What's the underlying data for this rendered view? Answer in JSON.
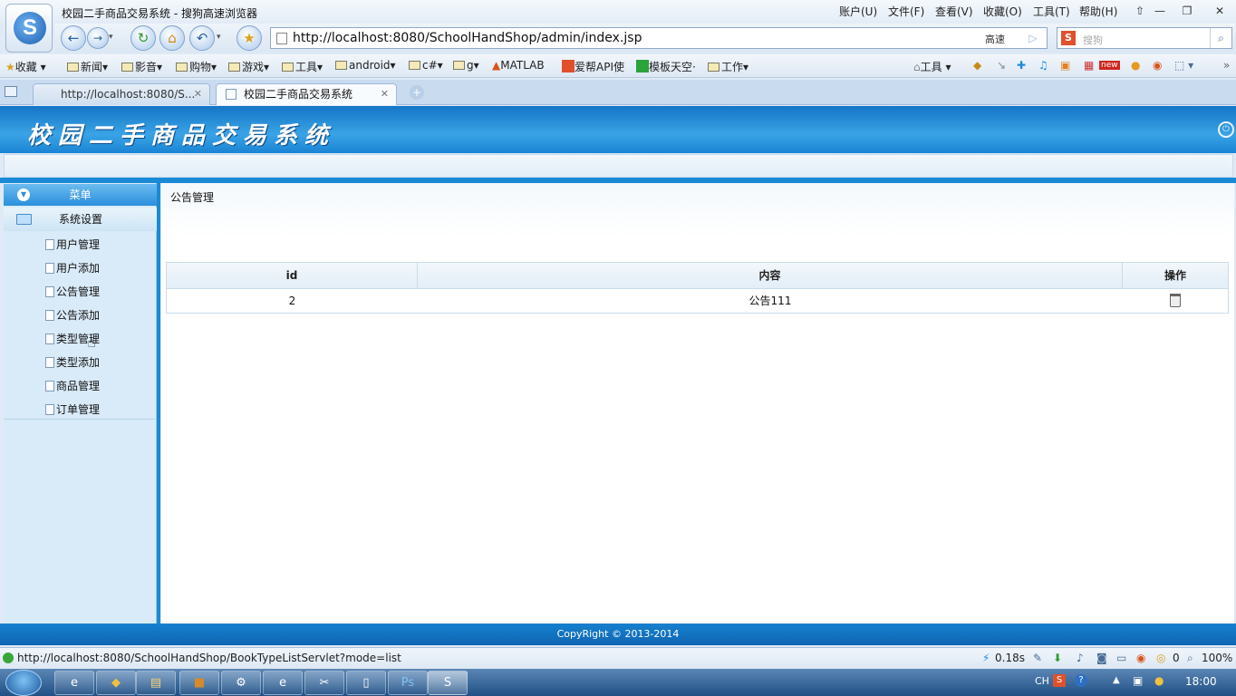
{
  "browser": {
    "window_title": "校园二手商品交易系统 - 搜狗高速浏览器",
    "menus": [
      "账户(U)",
      "文件(F)",
      "查看(V)",
      "收藏(O)",
      "工具(T)",
      "帮助(H)"
    ],
    "address": "http://localhost:8080/SchoolHandShop/admin/index.jsp",
    "speed_mode": "高速",
    "search_placeholder": "搜狗",
    "favorites": [
      "收藏",
      "新闻",
      "影音",
      "购物",
      "游戏",
      "工具",
      "android",
      "c#",
      "g",
      "MATLAB",
      "爱帮API使",
      "模板天空·",
      "工作"
    ],
    "tools_label": "工具",
    "new_badge": "new",
    "tabs": [
      {
        "label": "http://localhost:8080/S...",
        "active": false
      },
      {
        "label": "校园二手商品交易系统",
        "active": true
      }
    ]
  },
  "app": {
    "title": "校园二手商品交易系统",
    "sidebar": {
      "header": "菜单",
      "group": "系统设置",
      "items": [
        "用户管理",
        "用户添加",
        "公告管理",
        "公告添加",
        "类型管理",
        "类型添加",
        "商品管理",
        "订单管理"
      ]
    },
    "breadcrumb": "公告管理",
    "table": {
      "columns": [
        "id",
        "内容",
        "操作"
      ],
      "rows": [
        {
          "id": "2",
          "content": "公告111"
        }
      ]
    },
    "footer": "CopyRight © 2013-2014"
  },
  "status": {
    "url": "http://localhost:8080/SchoolHandShop/BookTypeListServlet?mode=list",
    "load_time": "0.18s",
    "count": "0",
    "zoom": "100%"
  },
  "taskbar": {
    "lang": "CH",
    "time": "18:00"
  },
  "colors": {
    "header_blue": "#1b8ad6",
    "sidebar_bg": "#d9ebf8",
    "footer_blue": "#1273c2"
  }
}
